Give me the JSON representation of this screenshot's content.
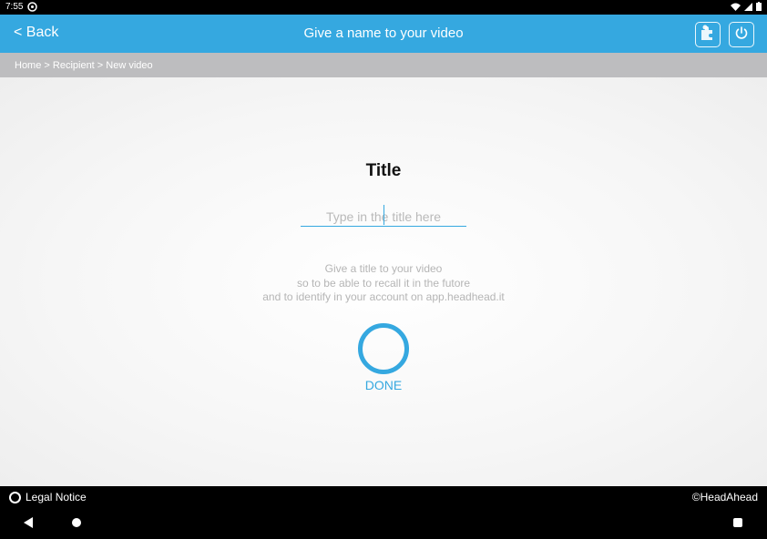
{
  "status_bar": {
    "time": "7:55",
    "icons": [
      "notification-icon",
      "wifi-icon",
      "signal-icon",
      "battery-icon"
    ]
  },
  "app_bar": {
    "back_label": "< Back",
    "title": "Give a name to your video",
    "actions": [
      "puzzle-icon",
      "power-icon"
    ]
  },
  "breadcrumb": {
    "text": "Home > Recipient > New video"
  },
  "form": {
    "heading": "Title",
    "input_placeholder": "Type in the title here",
    "input_value": "",
    "help_lines": [
      "Give a title to your video",
      "so to be able to recall it in the futore",
      "and to identify in your account on app.headhead.it"
    ],
    "done_label": "DONE"
  },
  "footer": {
    "legal_label": "Legal Notice",
    "copyright": "©HeadAhead"
  },
  "colors": {
    "accent": "#35a8e0",
    "breadcrumb_bg": "#bdbdbf",
    "help_text": "#b5b5b5"
  }
}
